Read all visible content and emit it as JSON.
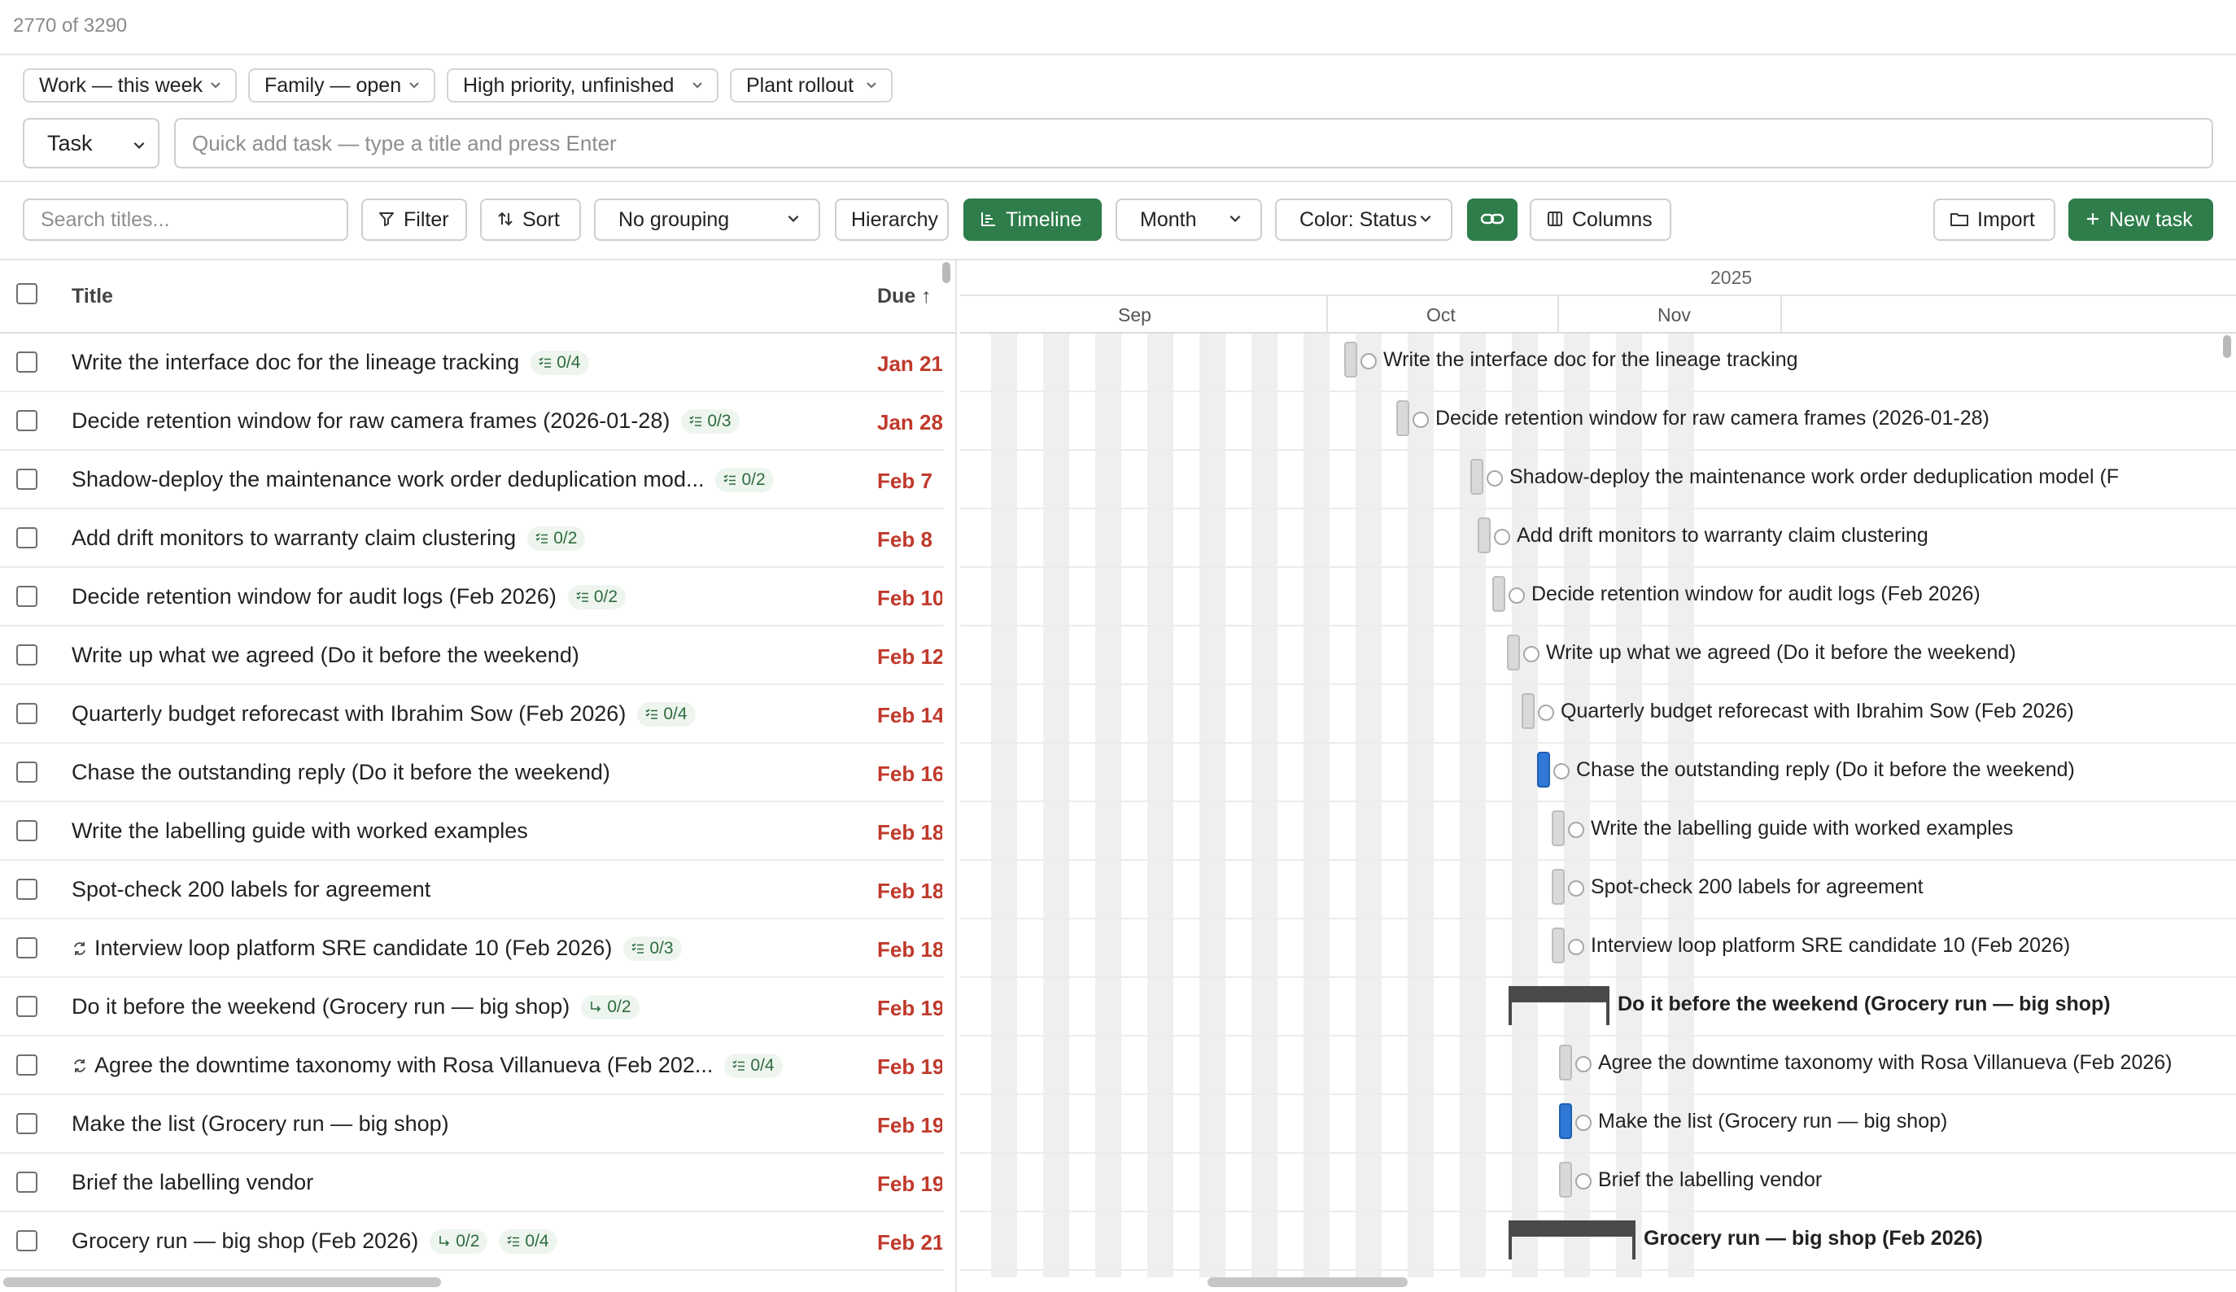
{
  "count_text": "2770 of 3290",
  "views": [
    {
      "label": "Work — this week"
    },
    {
      "label": "Family — open"
    },
    {
      "label": "High priority, unfinished"
    },
    {
      "label": "Plant rollout"
    }
  ],
  "quick_add": {
    "type": "Task",
    "placeholder": "Quick add task — type a title and press Enter"
  },
  "toolbar": {
    "search_placeholder": "Search titles...",
    "filter": "Filter",
    "sort": "Sort",
    "grouping": "No grouping",
    "hierarchy": "Hierarchy",
    "timeline": "Timeline",
    "scale": "Month",
    "color": "Color: Status",
    "columns": "Columns",
    "import": "Import",
    "new_task": "New task"
  },
  "list": {
    "header_title": "Title",
    "header_due": "Due ↑",
    "rows": [
      {
        "title": "Write the interface doc for the lineage tracking",
        "badges": [
          "0/4"
        ],
        "due": "Jan 21"
      },
      {
        "title": "Decide retention window for raw camera frames (2026-01-28)",
        "badges": [
          "0/3"
        ],
        "due": "Jan 28"
      },
      {
        "title": "Shadow-deploy the maintenance work order deduplication mod...",
        "badges": [
          "0/2"
        ],
        "due": "Feb 7"
      },
      {
        "title": "Add drift monitors to warranty claim clustering",
        "badges": [
          "0/2"
        ],
        "due": "Feb 8"
      },
      {
        "title": "Decide retention window for audit logs (Feb 2026)",
        "badges": [
          "0/2"
        ],
        "due": "Feb 10"
      },
      {
        "title": "Write up what we agreed (Do it before the weekend)",
        "badges": [],
        "due": "Feb 12"
      },
      {
        "title": "Quarterly budget reforecast with Ibrahim Sow (Feb 2026)",
        "badges": [
          "0/4"
        ],
        "due": "Feb 14"
      },
      {
        "title": "Chase the outstanding reply (Do it before the weekend)",
        "badges": [],
        "due": "Feb 16"
      },
      {
        "title": "Write the labelling guide with worked examples",
        "badges": [],
        "due": "Feb 18"
      },
      {
        "title": "Spot-check 200 labels for agreement",
        "badges": [],
        "due": "Feb 18"
      },
      {
        "title": "Interview loop platform SRE candidate 10 (Feb 2026)",
        "recurring": true,
        "badges": [
          "0/3"
        ],
        "due": "Feb 18"
      },
      {
        "title": "Do it before the weekend (Grocery run — big shop)",
        "subtask_badges": [
          "0/2"
        ],
        "badges": [],
        "due": "Feb 19"
      },
      {
        "title": "Agree the downtime taxonomy with Rosa Villanueva (Feb 202...",
        "recurring": true,
        "badges": [
          "0/4"
        ],
        "due": "Feb 19"
      },
      {
        "title": "Make the list (Grocery run — big shop)",
        "badges": [],
        "due": "Feb 19"
      },
      {
        "title": "Brief the labelling vendor",
        "badges": [],
        "due": "Feb 19"
      },
      {
        "title": "Grocery run — big shop (Feb 2026)",
        "subtask_badges": [
          "0/2"
        ],
        "badges": [
          "0/4"
        ],
        "due": "Feb 21"
      }
    ]
  },
  "timeline": {
    "year": "2025",
    "months": [
      "Sep",
      "Oct",
      "Nov"
    ],
    "rows": [
      {
        "label": "Write the interface doc for the lineage tracking"
      },
      {
        "label": "Decide retention window for raw camera frames (2026-01-28)"
      },
      {
        "label": "Shadow-deploy the maintenance work order deduplication model (F"
      },
      {
        "label": "Add drift monitors to warranty claim clustering"
      },
      {
        "label": "Decide retention window for audit logs (Feb 2026)"
      },
      {
        "label": "Write up what we agreed (Do it before the weekend)"
      },
      {
        "label": "Quarterly budget reforecast with Ibrahim Sow (Feb 2026)"
      },
      {
        "label": "Chase the outstanding reply (Do it before the weekend)"
      },
      {
        "label": "Write the labelling guide with worked examples"
      },
      {
        "label": "Spot-check 200 labels for agreement"
      },
      {
        "label": "Interview loop platform SRE candidate 10 (Feb 2026)"
      },
      {
        "label": "Do it before the weekend (Grocery run — big shop)"
      },
      {
        "label": "Agree the downtime taxonomy with Rosa Villanueva (Feb 2026)"
      },
      {
        "label": "Make the list (Grocery run — big shop)"
      },
      {
        "label": "Brief the labelling vendor"
      },
      {
        "label": "Grocery run — big shop (Feb 2026)"
      }
    ]
  },
  "colors": {
    "accent_green": "#2e7d4a",
    "overdue_red": "#c0392b",
    "progress_blue": "#2f78d6"
  }
}
